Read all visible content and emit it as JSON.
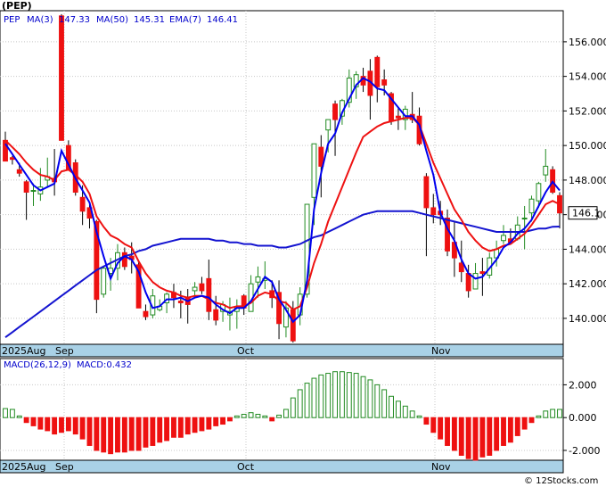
{
  "ticker_label": "(PEP)",
  "footer_credit": "© 12Stocks.com",
  "chart_data": [
    {
      "type": "candlestick",
      "legend": {
        "symbol": "PEP",
        "items": [
          {
            "label": "MA(3)",
            "value": "147.33",
            "color": "#0000cc"
          },
          {
            "label": "MA(50)",
            "value": "145.31",
            "color": "#0000cc"
          },
          {
            "label": "EMA(7)",
            "value": "146.41",
            "color": "#0000cc"
          }
        ]
      },
      "last_price_tag": "146.1",
      "y_ticks": [
        "156.000",
        "154.000",
        "152.000",
        "150.000",
        "148.000",
        "146.000",
        "144.000",
        "142.000",
        "140.000"
      ],
      "ylim": [
        138.5,
        157.8
      ],
      "x_labels": [
        "2025Aug",
        "Sep",
        "Oct",
        "Nov"
      ],
      "grid": true,
      "up_color": "#228b22",
      "down_color": "#ee1111",
      "ma3_color": "#0000ee",
      "ma50_color": "#1414d0",
      "ema7_color": "#ee1111",
      "candles": [
        [
          150.3,
          150.8,
          149.1,
          149.1
        ],
        [
          149.3,
          149.4,
          148.9,
          149.2
        ],
        [
          148.6,
          149.0,
          148.2,
          148.4
        ],
        [
          147.9,
          148.0,
          145.7,
          147.3
        ],
        [
          147.4,
          147.8,
          146.5,
          147.4
        ],
        [
          147.2,
          148.7,
          146.8,
          147.6
        ],
        [
          148.0,
          149.3,
          147.6,
          148.2
        ],
        [
          148.1,
          149.8,
          147.1,
          147.9
        ],
        [
          157.5,
          157.6,
          150.3,
          150.3
        ],
        [
          150.0,
          150.3,
          148.6,
          148.6
        ],
        [
          149.0,
          149.2,
          147.1,
          147.3
        ],
        [
          147.0,
          147.7,
          145.4,
          146.2
        ],
        [
          146.4,
          146.6,
          145.2,
          145.8
        ],
        [
          145.6,
          145.7,
          140.3,
          141.1
        ],
        [
          141.4,
          143.0,
          141.2,
          142.9
        ],
        [
          142.6,
          143.5,
          141.6,
          142.9
        ],
        [
          142.9,
          144.3,
          142.2,
          143.8
        ],
        [
          143.8,
          144.1,
          142.8,
          143.0
        ],
        [
          143.6,
          144.4,
          142.6,
          143.4
        ],
        [
          143.1,
          143.3,
          140.6,
          140.6
        ],
        [
          140.4,
          140.8,
          139.9,
          140.1
        ],
        [
          140.2,
          141.7,
          140.0,
          141.3
        ],
        [
          140.5,
          141.1,
          140.4,
          140.7
        ],
        [
          140.9,
          141.5,
          140.3,
          141.4
        ],
        [
          141.5,
          142.0,
          140.6,
          141.2
        ],
        [
          141.0,
          141.6,
          140.0,
          140.9
        ],
        [
          141.2,
          141.7,
          139.7,
          140.8
        ],
        [
          141.6,
          142.1,
          141.2,
          141.8
        ],
        [
          142.0,
          142.4,
          141.4,
          141.6
        ],
        [
          142.3,
          143.4,
          139.9,
          140.4
        ],
        [
          140.5,
          141.3,
          139.6,
          139.9
        ],
        [
          140.4,
          141.0,
          139.8,
          140.8
        ],
        [
          140.2,
          141.2,
          139.3,
          140.4
        ],
        [
          140.4,
          141.1,
          139.4,
          140.6
        ],
        [
          141.3,
          141.4,
          140.2,
          140.6
        ],
        [
          140.4,
          142.5,
          140.4,
          142.0
        ],
        [
          142.1,
          143.0,
          141.2,
          142.4
        ],
        [
          142.2,
          143.3,
          141.7,
          142.3
        ],
        [
          141.6,
          142.2,
          140.6,
          141.2
        ],
        [
          141.5,
          142.2,
          138.8,
          139.7
        ],
        [
          139.5,
          141.0,
          138.9,
          140.6
        ],
        [
          140.5,
          141.0,
          138.6,
          138.7
        ],
        [
          140.2,
          141.8,
          139.6,
          141.4
        ],
        [
          141.4,
          146.6,
          141.2,
          146.6
        ],
        [
          147.0,
          150.1,
          145.4,
          150.1
        ],
        [
          149.9,
          150.6,
          147.0,
          148.8
        ],
        [
          150.9,
          151.5,
          149.6,
          151.5
        ],
        [
          152.4,
          152.6,
          149.4,
          151.5
        ],
        [
          151.7,
          152.7,
          151.2,
          152.6
        ],
        [
          152.5,
          154.4,
          152.2,
          153.9
        ],
        [
          153.4,
          154.3,
          152.7,
          154.1
        ],
        [
          154.0,
          154.5,
          153.1,
          153.5
        ],
        [
          154.3,
          155.0,
          151.5,
          152.9
        ],
        [
          155.1,
          155.2,
          152.5,
          153.4
        ],
        [
          153.8,
          154.4,
          152.9,
          153.5
        ],
        [
          153.0,
          153.1,
          151.2,
          151.4
        ],
        [
          151.7,
          152.2,
          150.9,
          151.6
        ],
        [
          151.5,
          152.3,
          150.9,
          152.1
        ],
        [
          151.8,
          153.1,
          151.3,
          151.5
        ],
        [
          151.7,
          152.2,
          150.0,
          150.1
        ],
        [
          148.2,
          148.4,
          143.6,
          146.4
        ],
        [
          146.4,
          147.2,
          145.5,
          146.0
        ],
        [
          146.2,
          146.8,
          145.4,
          146.0
        ],
        [
          145.8,
          146.3,
          143.6,
          143.9
        ],
        [
          144.4,
          145.6,
          142.4,
          143.5
        ],
        [
          143.2,
          144.5,
          142.1,
          142.7
        ],
        [
          142.6,
          143.1,
          141.2,
          141.6
        ],
        [
          141.7,
          143.2,
          141.7,
          142.6
        ],
        [
          142.7,
          143.5,
          141.3,
          142.6
        ],
        [
          142.5,
          143.8,
          142.3,
          143.5
        ],
        [
          143.5,
          144.5,
          143.0,
          144.0
        ],
        [
          144.5,
          145.4,
          144.3,
          144.8
        ],
        [
          144.6,
          145.2,
          144.3,
          144.4
        ],
        [
          144.6,
          145.9,
          144.5,
          145.4
        ],
        [
          145.8,
          146.5,
          144.0,
          145.8
        ],
        [
          146.1,
          147.1,
          145.6,
          146.9
        ],
        [
          146.8,
          147.9,
          146.4,
          147.8
        ],
        [
          148.3,
          149.8,
          147.9,
          148.8
        ],
        [
          148.6,
          148.8,
          147.2,
          147.3
        ],
        [
          147.1,
          147.3,
          145.2,
          146.1
        ]
      ],
      "ma3": [
        150.1,
        149.5,
        148.9,
        148.3,
        147.7,
        147.4,
        147.6,
        147.8,
        149.7,
        148.9,
        148.1,
        147.4,
        146.7,
        145.0,
        143.6,
        142.3,
        143.2,
        143.6,
        143.4,
        142.7,
        141.5,
        140.6,
        140.7,
        141.1,
        141.1,
        141.2,
        141.0,
        141.2,
        141.3,
        141.2,
        140.8,
        140.5,
        140.3,
        140.6,
        140.6,
        141.0,
        141.7,
        142.4,
        142.1,
        141.1,
        140.5,
        139.8,
        140.2,
        142.2,
        146.3,
        148.4,
        150.1,
        150.7,
        151.9,
        152.7,
        153.5,
        153.9,
        153.7,
        153.3,
        153.2,
        152.7,
        152.2,
        151.7,
        151.7,
        151.2,
        149.7,
        148.3,
        146.1,
        145.2,
        144.5,
        143.4,
        142.6,
        142.3,
        142.4,
        142.9,
        143.4,
        144.1,
        144.4,
        144.9,
        145.2,
        145.7,
        146.5,
        147.3,
        147.9,
        147.4
      ],
      "ema7": [
        150.3,
        149.9,
        149.5,
        149.0,
        148.6,
        148.3,
        148.2,
        148.0,
        148.5,
        148.6,
        148.3,
        147.9,
        147.2,
        145.9,
        145.3,
        144.8,
        144.6,
        144.3,
        144.1,
        143.3,
        142.6,
        142.1,
        141.8,
        141.6,
        141.5,
        141.3,
        141.2,
        141.3,
        141.3,
        141.1,
        140.9,
        140.8,
        140.6,
        140.7,
        140.7,
        140.9,
        141.3,
        141.5,
        141.4,
        141.0,
        140.9,
        140.5,
        140.7,
        141.8,
        143.2,
        144.3,
        145.6,
        146.6,
        147.6,
        148.6,
        149.6,
        150.5,
        150.8,
        151.1,
        151.3,
        151.4,
        151.5,
        151.6,
        151.6,
        151.2,
        150.1,
        149.0,
        148.1,
        147.2,
        146.3,
        145.7,
        145.0,
        144.5,
        144.1,
        143.9,
        144.0,
        144.2,
        144.3,
        144.6,
        144.9,
        145.4,
        146.0,
        146.6,
        146.8,
        146.6
      ],
      "ma50": [
        138.9,
        139.2,
        139.5,
        139.8,
        140.1,
        140.4,
        140.7,
        141.0,
        141.3,
        141.6,
        141.9,
        142.2,
        142.5,
        142.8,
        143.0,
        143.2,
        143.4,
        143.6,
        143.7,
        143.9,
        144.0,
        144.2,
        144.3,
        144.4,
        144.5,
        144.6,
        144.6,
        144.6,
        144.6,
        144.6,
        144.5,
        144.5,
        144.4,
        144.4,
        144.3,
        144.3,
        144.2,
        144.2,
        144.2,
        144.1,
        144.1,
        144.2,
        144.3,
        144.5,
        144.7,
        144.8,
        145.0,
        145.2,
        145.4,
        145.6,
        145.8,
        146.0,
        146.1,
        146.2,
        146.2,
        146.2,
        146.2,
        146.2,
        146.2,
        146.1,
        146.0,
        145.9,
        145.8,
        145.7,
        145.6,
        145.5,
        145.4,
        145.3,
        145.2,
        145.1,
        145.0,
        145.0,
        145.0,
        145.0,
        145.0,
        145.1,
        145.2,
        145.2,
        145.3,
        145.31
      ]
    },
    {
      "type": "bar",
      "title": "MACD(26,12,9)",
      "legend_value": "MACD:0.432",
      "y_ticks": [
        "2.000",
        "0.000",
        "-2.000"
      ],
      "ylim": [
        -2.6,
        3.6
      ],
      "values": [
        0.55,
        0.5,
        0.1,
        -0.3,
        -0.5,
        -0.7,
        -0.8,
        -1.0,
        -0.9,
        -0.8,
        -1.0,
        -1.3,
        -1.7,
        -2.0,
        -2.1,
        -2.2,
        -2.1,
        -2.1,
        -2.0,
        -2.0,
        -1.8,
        -1.7,
        -1.5,
        -1.4,
        -1.2,
        -1.2,
        -1.0,
        -0.9,
        -0.8,
        -0.7,
        -0.5,
        -0.4,
        -0.2,
        0.1,
        0.2,
        0.3,
        0.2,
        0.1,
        -0.2,
        0.15,
        0.5,
        1.2,
        1.7,
        2.1,
        2.4,
        2.6,
        2.7,
        2.8,
        2.8,
        2.75,
        2.7,
        2.5,
        2.3,
        2.0,
        1.7,
        1.3,
        1.0,
        0.7,
        0.4,
        0.1,
        -0.4,
        -0.9,
        -1.3,
        -1.7,
        -2.0,
        -2.3,
        -2.5,
        -2.6,
        -2.4,
        -2.3,
        -2.0,
        -1.7,
        -1.5,
        -1.1,
        -0.7,
        -0.3,
        0.1,
        0.4,
        0.5,
        0.5
      ],
      "up_color": "#228b22",
      "down_color": "#ee1111"
    }
  ]
}
